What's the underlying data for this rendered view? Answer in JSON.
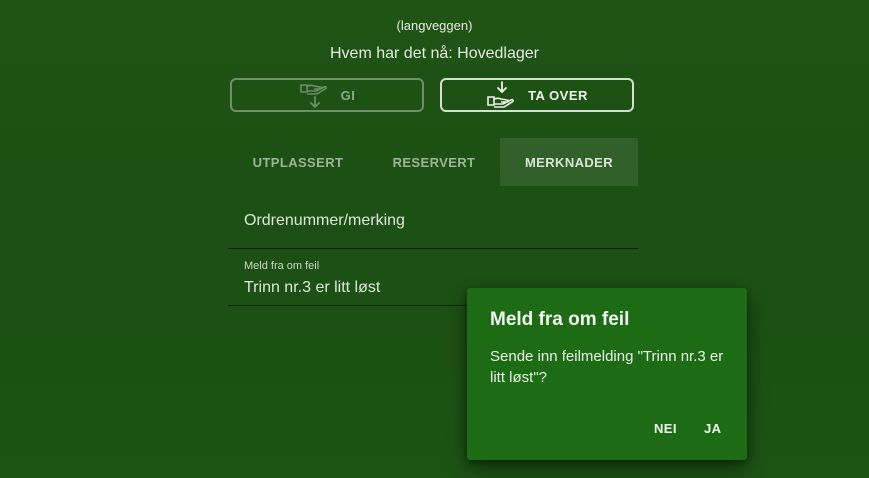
{
  "item": {
    "location": "(langveggen)",
    "holder_text": "Hvem har det nå: Hovedlager"
  },
  "actions": {
    "give_label": "GI",
    "take_label": "TA OVER"
  },
  "tabs": [
    {
      "label": "UTPLASSERT"
    },
    {
      "label": "RESERVERT"
    },
    {
      "label": "MERKNADER",
      "active": true
    }
  ],
  "fields": {
    "order_value": "Ordrenummer/merking",
    "report_label": "Meld fra om feil",
    "report_value": "Trinn nr.3 er litt løst"
  },
  "dialog": {
    "title": "Meld fra om feil",
    "message": "Sende inn feilmelding \"Trinn nr.3 er litt løst\"?",
    "no_label": "NEI",
    "yes_label": "JA"
  },
  "icons": {
    "give": "hand-give-icon",
    "take": "hand-take-icon"
  },
  "colors": {
    "background": "#1d5214",
    "dialog": "#1e6b16"
  }
}
